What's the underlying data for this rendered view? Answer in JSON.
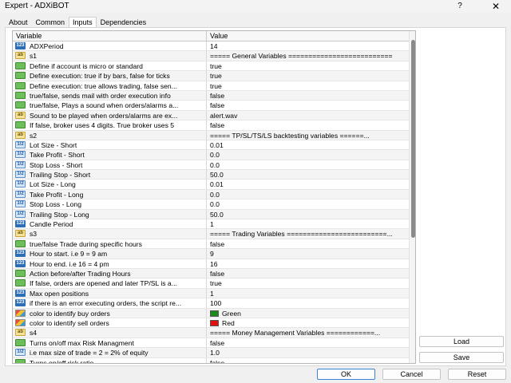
{
  "window": {
    "title": "Expert - ADXiBOT",
    "help_label": "?",
    "close_label": "✕"
  },
  "tabs": [
    {
      "label": "About"
    },
    {
      "label": "Common"
    },
    {
      "label": "Inputs"
    },
    {
      "label": "Dependencies"
    }
  ],
  "active_tab": "Inputs",
  "grid": {
    "columns": [
      "Variable",
      "Value"
    ],
    "rows": [
      {
        "type": "int",
        "icon": "int-type-icon",
        "icon_text": "123",
        "variable": "ADXPeriod",
        "value": "14"
      },
      {
        "type": "str",
        "icon": "string-type-icon",
        "icon_text": "ab",
        "variable": "s1",
        "value": "===== General Variables =========================="
      },
      {
        "type": "bool",
        "icon": "bool-type-icon",
        "icon_text": "",
        "variable": "Define if account is micro or standard",
        "value": "true"
      },
      {
        "type": "bool",
        "icon": "bool-type-icon",
        "icon_text": "",
        "variable": "Define execution: true if by bars, false for ticks",
        "value": "true"
      },
      {
        "type": "bool",
        "icon": "bool-type-icon",
        "icon_text": "",
        "variable": "Define execution: true allows trading, false sen...",
        "value": "true"
      },
      {
        "type": "bool",
        "icon": "bool-type-icon",
        "icon_text": "",
        "variable": "true/false, sends mail with order execution info",
        "value": "false"
      },
      {
        "type": "bool",
        "icon": "bool-type-icon",
        "icon_text": "",
        "variable": "true/false, Plays a sound when orders/alarms a...",
        "value": "false"
      },
      {
        "type": "str",
        "icon": "string-type-icon",
        "icon_text": "ab",
        "variable": "Sound to be played when orders/alarms are ex...",
        "value": "alert.wav"
      },
      {
        "type": "bool",
        "icon": "bool-type-icon",
        "icon_text": "",
        "variable": "If false, broker uses 4 digits. True broker uses 5",
        "value": "false"
      },
      {
        "type": "str",
        "icon": "string-type-icon",
        "icon_text": "ab",
        "variable": "s2",
        "value": "=====  TP/SL/TS/LS backtesting variables ======..."
      },
      {
        "type": "dbl",
        "icon": "double-type-icon",
        "icon_text": "1/2",
        "variable": "Lot Size - Short",
        "value": "0.01"
      },
      {
        "type": "dbl",
        "icon": "double-type-icon",
        "icon_text": "1/2",
        "variable": "Take Profit - Short",
        "value": "0.0"
      },
      {
        "type": "dbl",
        "icon": "double-type-icon",
        "icon_text": "1/2",
        "variable": "Stop Loss - Short",
        "value": "0.0"
      },
      {
        "type": "dbl",
        "icon": "double-type-icon",
        "icon_text": "1/2",
        "variable": "Trailing Stop - Short",
        "value": "50.0"
      },
      {
        "type": "dbl",
        "icon": "double-type-icon",
        "icon_text": "1/2",
        "variable": "Lot Size - Long",
        "value": "0.01"
      },
      {
        "type": "dbl",
        "icon": "double-type-icon",
        "icon_text": "1/2",
        "variable": "Take Profit - Long",
        "value": "0.0"
      },
      {
        "type": "dbl",
        "icon": "double-type-icon",
        "icon_text": "1/2",
        "variable": "Stop Loss - Long",
        "value": "0.0"
      },
      {
        "type": "dbl",
        "icon": "double-type-icon",
        "icon_text": "1/2",
        "variable": "Trailing Stop - Long",
        "value": "50.0"
      },
      {
        "type": "int",
        "icon": "int-type-icon",
        "icon_text": "123",
        "variable": "Candle Period",
        "value": "1"
      },
      {
        "type": "str",
        "icon": "string-type-icon",
        "icon_text": "ab",
        "variable": "s3",
        "value": "===== Trading Variables =========================..."
      },
      {
        "type": "bool",
        "icon": "bool-type-icon",
        "icon_text": "",
        "variable": "true/false Trade during specific hours",
        "value": "false"
      },
      {
        "type": "int",
        "icon": "int-type-icon",
        "icon_text": "123",
        "variable": "Hour to start. i.e 9 = 9 am",
        "value": "9"
      },
      {
        "type": "int",
        "icon": "int-type-icon",
        "icon_text": "123",
        "variable": "Hour to end. i.e 16 = 4 pm",
        "value": "16"
      },
      {
        "type": "bool",
        "icon": "bool-type-icon",
        "icon_text": "",
        "variable": "Action before/after Trading Hours",
        "value": "false"
      },
      {
        "type": "bool",
        "icon": "bool-type-icon",
        "icon_text": "",
        "variable": "If false, orders are opened and later TP/SL is a...",
        "value": "true"
      },
      {
        "type": "int",
        "icon": "int-type-icon",
        "icon_text": "123",
        "variable": "Max open positions",
        "value": "1"
      },
      {
        "type": "int",
        "icon": "int-type-icon",
        "icon_text": "123",
        "variable": "if there is an error executing orders, the script re...",
        "value": "100"
      },
      {
        "type": "col",
        "icon": "color-type-icon",
        "icon_text": "",
        "variable": "color to identify buy orders",
        "value": "Green",
        "swatch": "#1a8a1a"
      },
      {
        "type": "col",
        "icon": "color-type-icon",
        "icon_text": "",
        "variable": "color to identify sell orders",
        "value": "Red",
        "swatch": "#e01010"
      },
      {
        "type": "str",
        "icon": "string-type-icon",
        "icon_text": "ab",
        "variable": "s4",
        "value": "===== Money Management Variables ============..."
      },
      {
        "type": "bool",
        "icon": "bool-type-icon",
        "icon_text": "",
        "variable": "Turns on/off max Risk Managment",
        "value": "false"
      },
      {
        "type": "dbl",
        "icon": "double-type-icon",
        "icon_text": "1/2",
        "variable": "i.e max size of trade = 2 = 2% of equity",
        "value": "1.0"
      },
      {
        "type": "bool",
        "icon": "bool-type-icon",
        "icon_text": "",
        "variable": "Turns on/off risk ratio",
        "value": "false"
      }
    ]
  },
  "side_buttons": {
    "load": "Load",
    "save": "Save"
  },
  "dialog_buttons": {
    "ok": "OK",
    "cancel": "Cancel",
    "reset": "Reset"
  }
}
